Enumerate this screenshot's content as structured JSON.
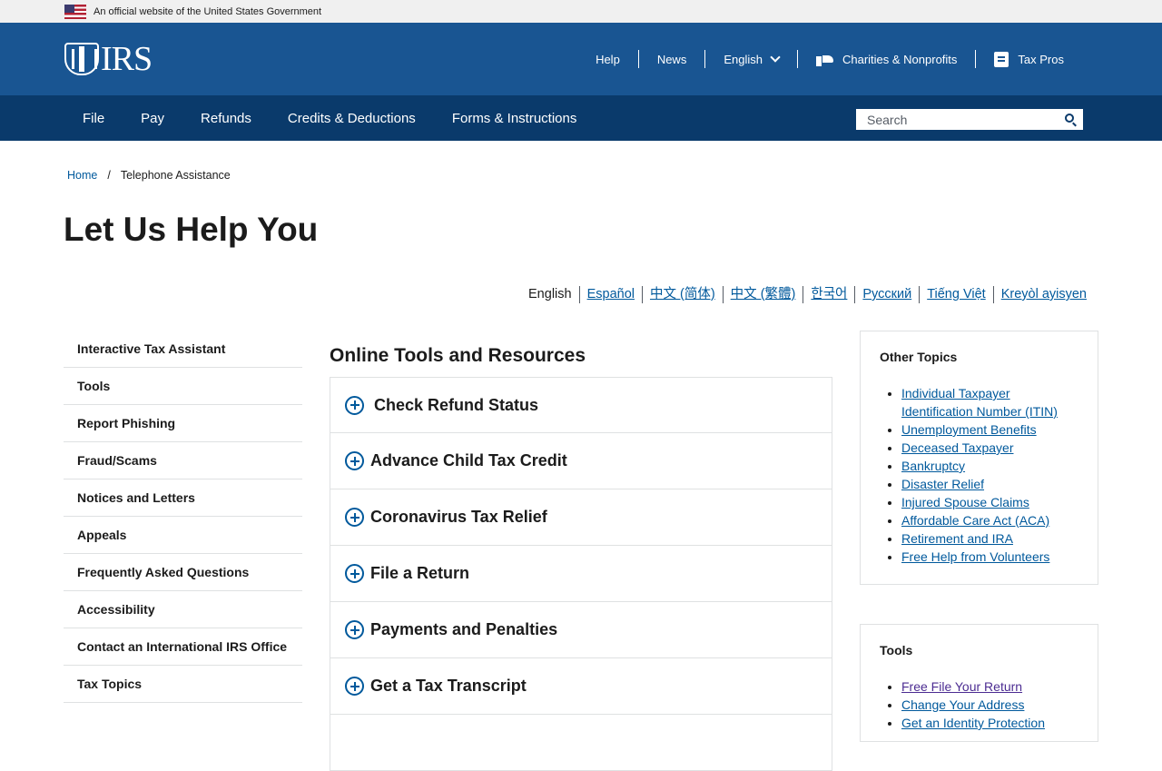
{
  "gov_banner": {
    "text": "An official website of the United States Government"
  },
  "header": {
    "logo_text": "IRS",
    "util_nav": {
      "help": "Help",
      "news": "News",
      "language": "English",
      "charities": "Charities & Nonprofits",
      "tax_pros": "Tax Pros"
    }
  },
  "main_nav": {
    "items": [
      "File",
      "Pay",
      "Refunds",
      "Credits & Deductions",
      "Forms & Instructions"
    ],
    "search_placeholder": "Search"
  },
  "breadcrumb": {
    "home": "Home",
    "separator": "/",
    "current": "Telephone Assistance"
  },
  "page_title": "Let Us Help You",
  "languages": [
    "English",
    "Español",
    "中文 (简体)",
    "中文 (繁體)",
    "한국어",
    "Русский",
    "Tiếng Việt",
    "Kreyòl ayisyen"
  ],
  "sidebar": {
    "items": [
      "Interactive Tax Assistant",
      "Tools",
      "Report Phishing",
      "Fraud/Scams",
      "Notices and Letters",
      "Appeals",
      "Frequently Asked Questions",
      "Accessibility",
      "Contact an International IRS Office",
      "Tax Topics"
    ]
  },
  "content": {
    "section_title": "Online Tools and Resources",
    "accordion": [
      "Check Refund Status",
      "Advance Child Tax Credit",
      "Coronavirus Tax Relief",
      "File a Return",
      "Payments and Penalties",
      "Get a Tax Transcript"
    ]
  },
  "other_topics": {
    "title": "Other Topics",
    "links": [
      "Individual Taxpayer Identification Number (ITIN)",
      "Unemployment Benefits",
      "Deceased Taxpayer",
      "Bankruptcy",
      "Disaster Relief",
      "Injured Spouse Claims",
      "Affordable Care Act (ACA)",
      "Retirement and IRA",
      "Free Help from Volunteers"
    ]
  },
  "tools_box": {
    "title": "Tools",
    "links": [
      "Free File Your Return",
      "Change Your Address",
      "Get an Identity Protection"
    ]
  },
  "colors": {
    "header": "#195592",
    "nav": "#0a3a6b",
    "link": "#00599c",
    "visited": "#4c2c92"
  }
}
